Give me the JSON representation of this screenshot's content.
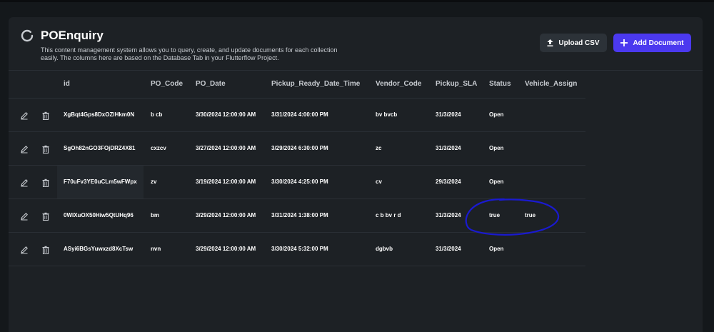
{
  "header": {
    "title": "POEnquiry",
    "description": "This content management system allows you to query, create, and update documents for each collection easily. The columns here are based on the Database Tab in your Flutterflow Project.",
    "upload_label": "Upload CSV",
    "add_label": "Add Document"
  },
  "table": {
    "columns": [
      "id",
      "PO_Code",
      "PO_Date",
      "Pickup_Ready_Date_Time",
      "Vendor_Code",
      "Pickup_SLA",
      "Status",
      "Vehicle_Assign"
    ],
    "rows": [
      {
        "id": "XgBqt4Gps8DxOZlHkm0N",
        "po_code": "b cb",
        "po_date": "3/30/2024 12:00:00 AM",
        "pickup": "3/31/2024 4:00:00 PM",
        "vendor": "bv  bvcb",
        "sla": "31/3/2024",
        "status": "Open",
        "vehicle": ""
      },
      {
        "id": "SgOh82nGO3FOjDRZ4X81",
        "po_code": "cxzcv",
        "po_date": "3/27/2024 12:00:00 AM",
        "pickup": "3/29/2024 6:30:00 PM",
        "vendor": "zc",
        "sla": "31/3/2024",
        "status": "Open",
        "vehicle": ""
      },
      {
        "id": "F70uFv3YE0uCLm5wFWpx",
        "po_code": "zv",
        "po_date": "3/19/2024 12:00:00 AM",
        "pickup": "3/30/2024 4:25:00 PM",
        "vendor": " cv",
        "sla": "29/3/2024",
        "status": "Open",
        "vehicle": ""
      },
      {
        "id": "0WIXuOX50Hiw5QtUHq96",
        "po_code": "bm",
        "po_date": "3/29/2024 12:00:00 AM",
        "pickup": "3/31/2024 1:38:00 PM",
        "vendor": "c b bv r d",
        "sla": "31/3/2024",
        "status": "true",
        "vehicle": "true"
      },
      {
        "id": "ASyi6BGsYuwxzd8XcTsw",
        "po_code": " nvn",
        "po_date": "3/29/2024 12:00:00 AM",
        "pickup": "3/30/2024 5:32:00 PM",
        "vendor": "dgbvb",
        "sla": "31/3/2024",
        "status": "Open",
        "vehicle": ""
      }
    ]
  },
  "icons": {
    "logo": "spinner-logo-icon",
    "upload": "upload-icon",
    "add": "plus-icon",
    "edit": "pencil-icon",
    "delete": "trash-icon"
  },
  "colors": {
    "accent": "#4b39ef",
    "annotation": "#1a1ad0",
    "background": "#14181b",
    "panel": "#1d2125"
  }
}
